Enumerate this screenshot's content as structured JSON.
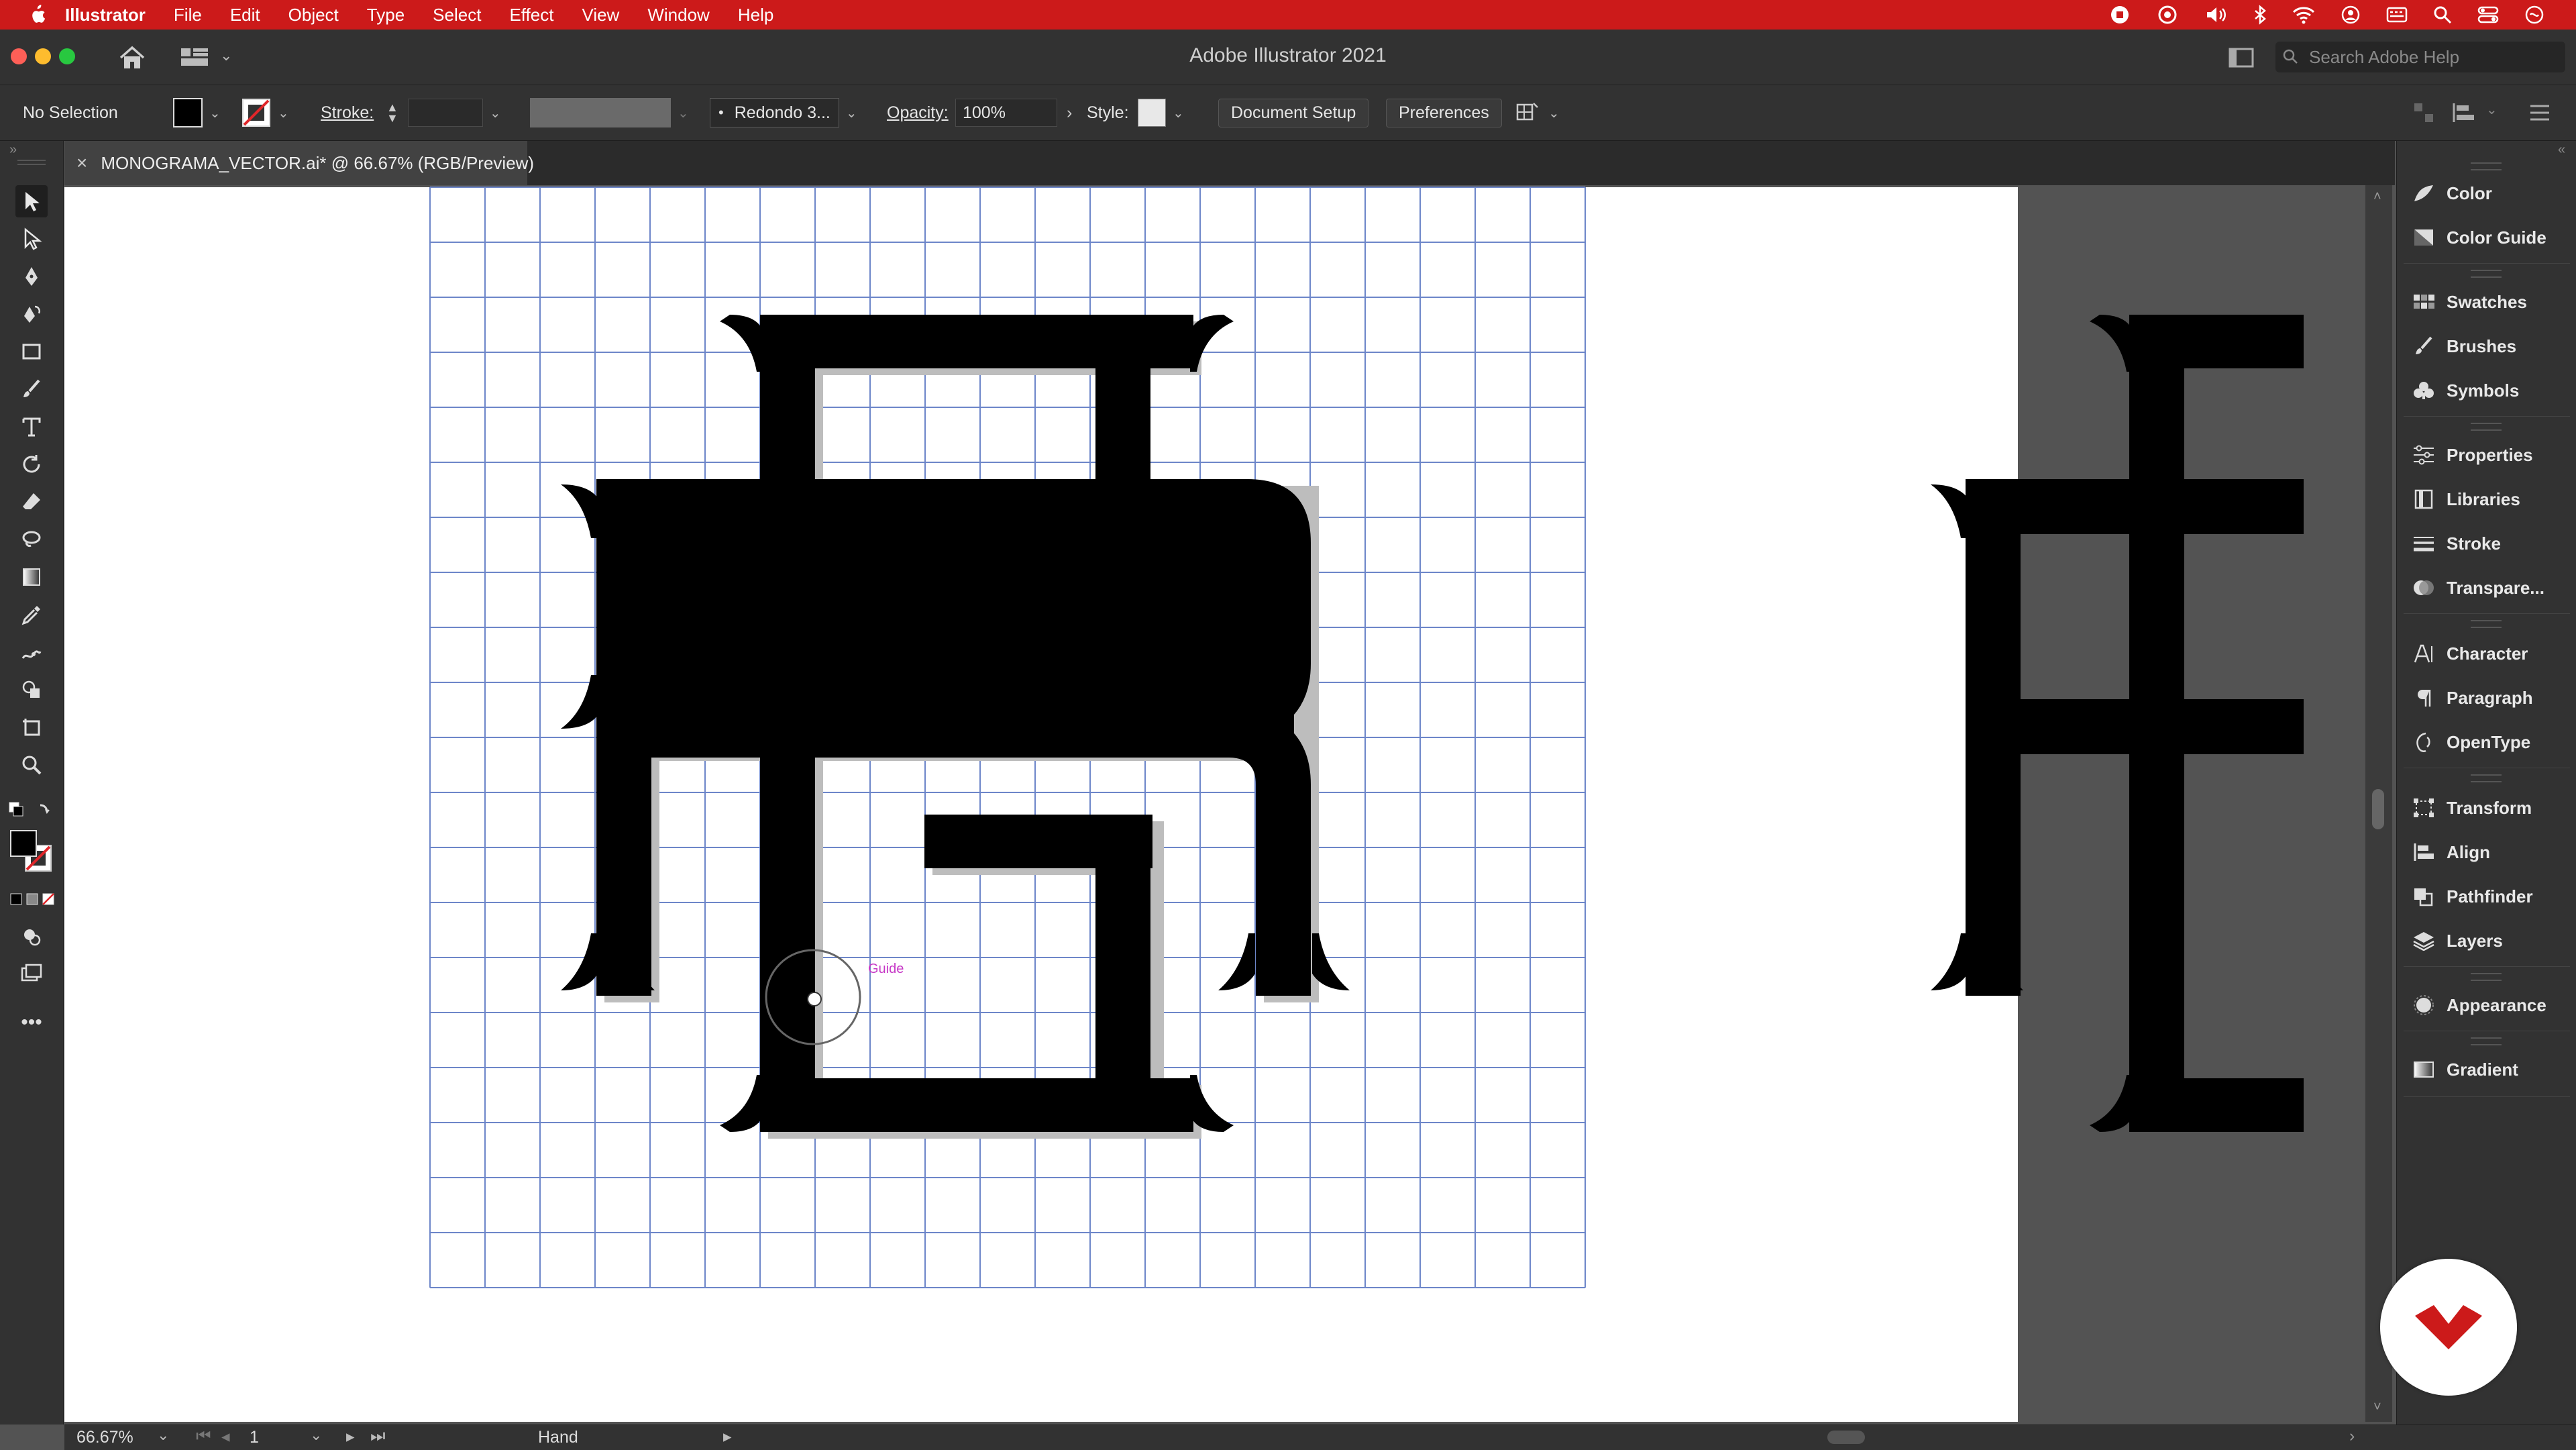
{
  "menubar": {
    "items": [
      "Illustrator",
      "File",
      "Edit",
      "Object",
      "Type",
      "Select",
      "Effect",
      "View",
      "Window",
      "Help"
    ],
    "status_icons": [
      "record-icon",
      "creative-cloud-icon",
      "volume-icon",
      "bluetooth-icon",
      "wifi-icon",
      "user-icon",
      "keyboard-icon",
      "spotlight-icon",
      "control-center-icon",
      "siri-icon"
    ]
  },
  "window": {
    "title": "Adobe Illustrator 2021",
    "search_placeholder": "Search Adobe Help"
  },
  "control_bar": {
    "selection": "No Selection",
    "stroke_label": "Stroke:",
    "brush": "Redondo 3...",
    "opacity_label": "Opacity:",
    "opacity_value": "100%",
    "style_label": "Style:",
    "document_setup": "Document Setup",
    "preferences": "Preferences"
  },
  "document_tab": {
    "close": "×",
    "name": "MONOGRAMA_VECTOR.ai* @ 66.67% (RGB/Preview)"
  },
  "canvas": {
    "guide_label": "Guide"
  },
  "right_panel": {
    "groups": [
      {
        "items": [
          {
            "label": "Color",
            "icon": "color-icon"
          },
          {
            "label": "Color Guide",
            "icon": "color-guide-icon"
          }
        ]
      },
      {
        "items": [
          {
            "label": "Swatches",
            "icon": "swatches-icon"
          },
          {
            "label": "Brushes",
            "icon": "brushes-icon"
          },
          {
            "label": "Symbols",
            "icon": "symbols-icon"
          }
        ]
      },
      {
        "items": [
          {
            "label": "Properties",
            "icon": "properties-icon"
          },
          {
            "label": "Libraries",
            "icon": "libraries-icon"
          },
          {
            "label": "Stroke",
            "icon": "stroke-icon"
          },
          {
            "label": "Transpare...",
            "icon": "transparency-icon"
          }
        ]
      },
      {
        "items": [
          {
            "label": "Character",
            "icon": "character-icon"
          },
          {
            "label": "Paragraph",
            "icon": "paragraph-icon"
          },
          {
            "label": "OpenType",
            "icon": "opentype-icon"
          }
        ]
      },
      {
        "items": [
          {
            "label": "Transform",
            "icon": "transform-icon"
          },
          {
            "label": "Align",
            "icon": "align-icon"
          },
          {
            "label": "Pathfinder",
            "icon": "pathfinder-icon"
          },
          {
            "label": "Layers",
            "icon": "layers-icon"
          }
        ]
      },
      {
        "items": [
          {
            "label": "Appearance",
            "icon": "appearance-icon"
          }
        ]
      },
      {
        "items": [
          {
            "label": "Gradient",
            "icon": "gradient-icon"
          }
        ]
      }
    ]
  },
  "status_bar": {
    "zoom": "66.67%",
    "artboard": "1",
    "tool": "Hand"
  },
  "colors": {
    "menubar": "#cc1a1a",
    "ui_dark": "#323232",
    "pasteboard": "#535353",
    "grid": "#6d86c9",
    "glyph": "#000000",
    "guide": "#c637c6",
    "logo": "#cc1a1a"
  }
}
